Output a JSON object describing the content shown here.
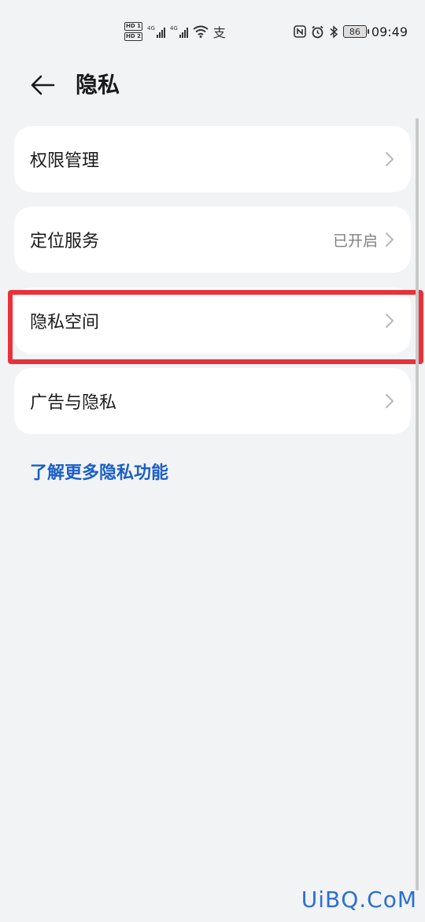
{
  "status_bar": {
    "hd1": "HD 1",
    "hd2": "HD 2",
    "net1": "4G",
    "net2": "4G",
    "alipay_glyph": "支",
    "nfc_glyph": "N",
    "battery": "86",
    "time": "09:49"
  },
  "header": {
    "title": "隐私"
  },
  "menu": {
    "items": [
      {
        "label": "权限管理",
        "value": ""
      },
      {
        "label": "定位服务",
        "value": "已开启"
      },
      {
        "label": "隐私空间",
        "value": ""
      },
      {
        "label": "广告与隐私",
        "value": ""
      }
    ]
  },
  "link": {
    "more_privacy": "了解更多隐私功能"
  },
  "watermark": "UiBQ.CoM",
  "colors": {
    "background": "#f1f3f5",
    "card": "#ffffff",
    "link": "#1a5fc8",
    "highlight": "#e8323a"
  }
}
